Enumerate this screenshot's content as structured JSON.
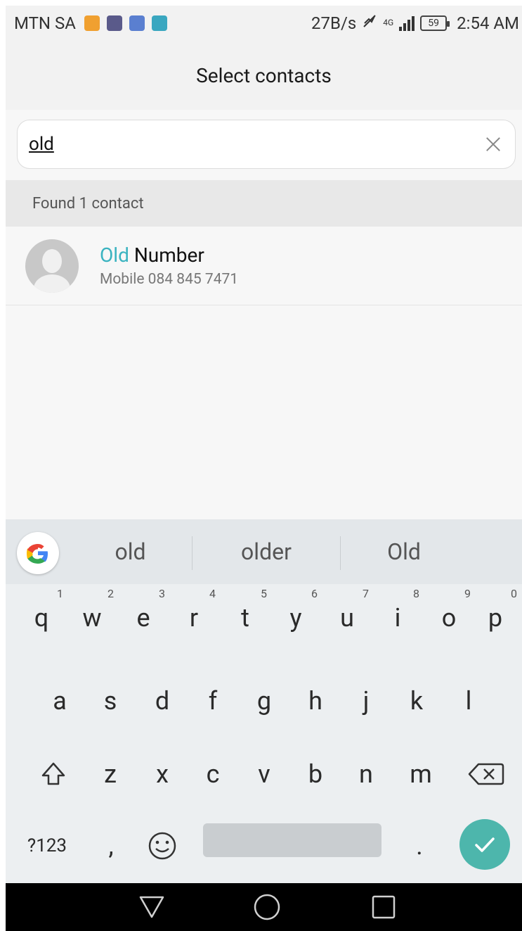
{
  "status_bar": {
    "carrier": "MTN SA",
    "speed": "27B/s",
    "network": "4G",
    "battery": "59",
    "time": "2:54 AM",
    "icon_colors": [
      "#f0a030",
      "#5a5a8a",
      "#5a7fd0",
      "#3aa7c0"
    ]
  },
  "header": {
    "title": "Select contacts"
  },
  "search": {
    "value": "old"
  },
  "results": {
    "found_label": "Found 1 contact"
  },
  "contact": {
    "name_highlight": "Old",
    "name_rest": " Number",
    "detail": "Mobile 084 845 7471"
  },
  "keyboard": {
    "suggestions": [
      "old",
      "older",
      "Old"
    ],
    "row1": [
      "q",
      "w",
      "e",
      "r",
      "t",
      "y",
      "u",
      "i",
      "o",
      "p"
    ],
    "row1_hints": [
      "1",
      "2",
      "3",
      "4",
      "5",
      "6",
      "7",
      "8",
      "9",
      "0"
    ],
    "row2": [
      "a",
      "s",
      "d",
      "f",
      "g",
      "h",
      "j",
      "k",
      "l"
    ],
    "row3": [
      "z",
      "x",
      "c",
      "v",
      "b",
      "n",
      "m"
    ],
    "symbols_label": "?123",
    "comma": ",",
    "period": ".",
    "accent_color": "#4db6ac"
  }
}
